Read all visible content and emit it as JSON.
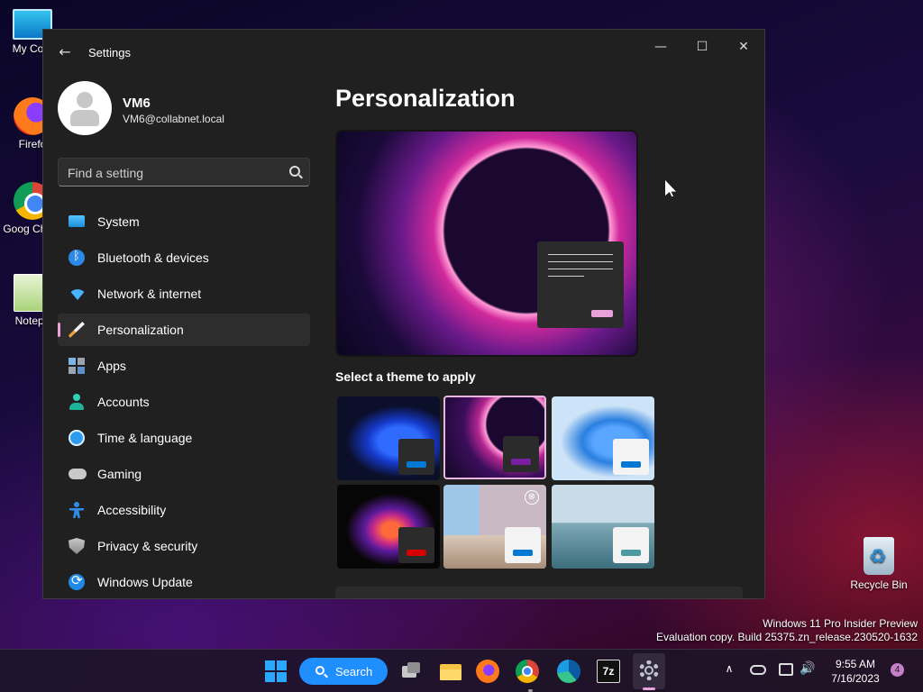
{
  "desktop": {
    "icons": [
      {
        "label": "My Com"
      },
      {
        "label": "Firefo"
      },
      {
        "label": "Goog Chron"
      },
      {
        "label": "Notepa"
      }
    ],
    "recycle_bin": "Recycle Bin",
    "watermark": {
      "line1": "Windows 11 Pro Insider Preview",
      "line2": "Evaluation copy. Build 25375.zn_release.230520-1632"
    }
  },
  "window": {
    "title": "Settings",
    "back_icon": "←",
    "minimize_icon": "—",
    "maximize_icon": "☐",
    "close_icon": "✕"
  },
  "profile": {
    "name": "VM6",
    "email": "VM6@collabnet.local"
  },
  "search": {
    "placeholder": "Find a setting"
  },
  "sidebar": {
    "items": [
      {
        "label": "System",
        "icon": "system-icon"
      },
      {
        "label": "Bluetooth & devices",
        "icon": "bluetooth-icon"
      },
      {
        "label": "Network & internet",
        "icon": "wifi-icon"
      },
      {
        "label": "Personalization",
        "icon": "brush-icon",
        "active": true
      },
      {
        "label": "Apps",
        "icon": "apps-icon"
      },
      {
        "label": "Accounts",
        "icon": "person-icon"
      },
      {
        "label": "Time & language",
        "icon": "globe-clock-icon"
      },
      {
        "label": "Gaming",
        "icon": "controller-icon"
      },
      {
        "label": "Accessibility",
        "icon": "accessibility-icon"
      },
      {
        "label": "Privacy & security",
        "icon": "shield-icon"
      },
      {
        "label": "Windows Update",
        "icon": "update-icon"
      }
    ],
    "active_indicator_color": "#e8a2d8"
  },
  "main": {
    "title": "Personalization",
    "theme_section_label": "Select a theme to apply",
    "selected_theme_index": 1,
    "themes": [
      {
        "name": "windows-dark-bloom",
        "mode": "dark",
        "accent": "#0078d4"
      },
      {
        "name": "windows-glow",
        "mode": "dark",
        "accent": "#7b1fa2"
      },
      {
        "name": "windows-light-bloom",
        "mode": "light",
        "accent": "#0078d4"
      },
      {
        "name": "captured-motion",
        "mode": "dark",
        "accent": "#d50000"
      },
      {
        "name": "flow",
        "mode": "light",
        "accent": "#0078d4"
      },
      {
        "name": "sunrise",
        "mode": "light",
        "accent": "#4a9aa0"
      }
    ],
    "accent_color": "#e8a2d8"
  },
  "taskbar": {
    "search_label": "Search",
    "seven_zip_label": "7z",
    "clock_time": "9:55 AM",
    "clock_date": "7/16/2023",
    "notification_count": "4",
    "tray_chevron": "∧",
    "volume_icon": "🔊"
  }
}
